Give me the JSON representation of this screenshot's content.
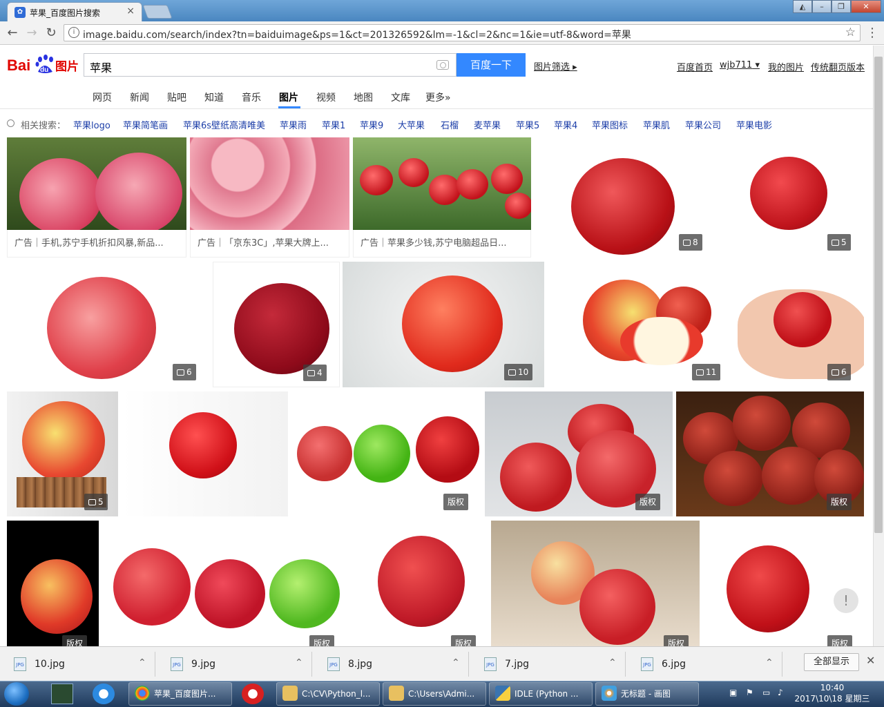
{
  "browser": {
    "tab_title": "苹果_百度图片搜索",
    "url": "image.baidu.com/search/index?tn=baiduimage&ps=1&ct=201326592&lm=-1&cl=2&nc=1&ie=utf-8&word=苹果"
  },
  "header": {
    "logo_text": "Bai du图片",
    "search_value": "苹果",
    "search_button": "百度一下",
    "filter_label": "图片筛选",
    "links": [
      "百度首页",
      "wjb711",
      "我的图片",
      "传统翻页版本"
    ]
  },
  "nav": {
    "tabs": [
      "网页",
      "新闻",
      "贴吧",
      "知道",
      "音乐",
      "图片",
      "视频",
      "地图",
      "文库",
      "更多»"
    ],
    "active": "图片"
  },
  "related": {
    "label": "相关搜索：",
    "items": [
      "苹果logo",
      "苹果简笔画",
      "苹果6s壁纸高清唯美",
      "苹果雨",
      "苹果1",
      "苹果9",
      "大苹果",
      "石榴",
      "麦苹果",
      "苹果5",
      "苹果4",
      "苹果图标",
      "苹果肌",
      "苹果公司",
      "苹果电影"
    ]
  },
  "ads": [
    "广告｜手机,苏宁手机折扣风暴,新品...",
    "广告｜「京东3C」,苹果大牌上...",
    "广告｜苹果多少钱,苏宁电脑超品日..."
  ],
  "badges": {
    "r1a": "8",
    "r1b": "5",
    "r2a": "6",
    "r2b": "4",
    "r2c": "10",
    "r2d": "11",
    "r2e": "6",
    "r3a": "5",
    "r3b": "版权",
    "r3c": "版权",
    "r3d": "版权",
    "r4a": "版权",
    "r4b": "版权",
    "r4c": "版权",
    "r4d": "版权",
    "r4e": "版权"
  },
  "feedback": "!",
  "downloads": [
    "10.jpg",
    "9.jpg",
    "8.jpg",
    "7.jpg",
    "6.jpg"
  ],
  "download_icon": "JPG",
  "show_all": "全部显示",
  "taskbar": {
    "buttons": [
      "苹果_百度图片...",
      "C:\\CV\\Python_l...",
      "C:\\Users\\Admi...",
      "IDLE (Python ...",
      "无标题 - 画图"
    ],
    "time": "10:40",
    "date": "2017\\10\\18 星期三"
  }
}
